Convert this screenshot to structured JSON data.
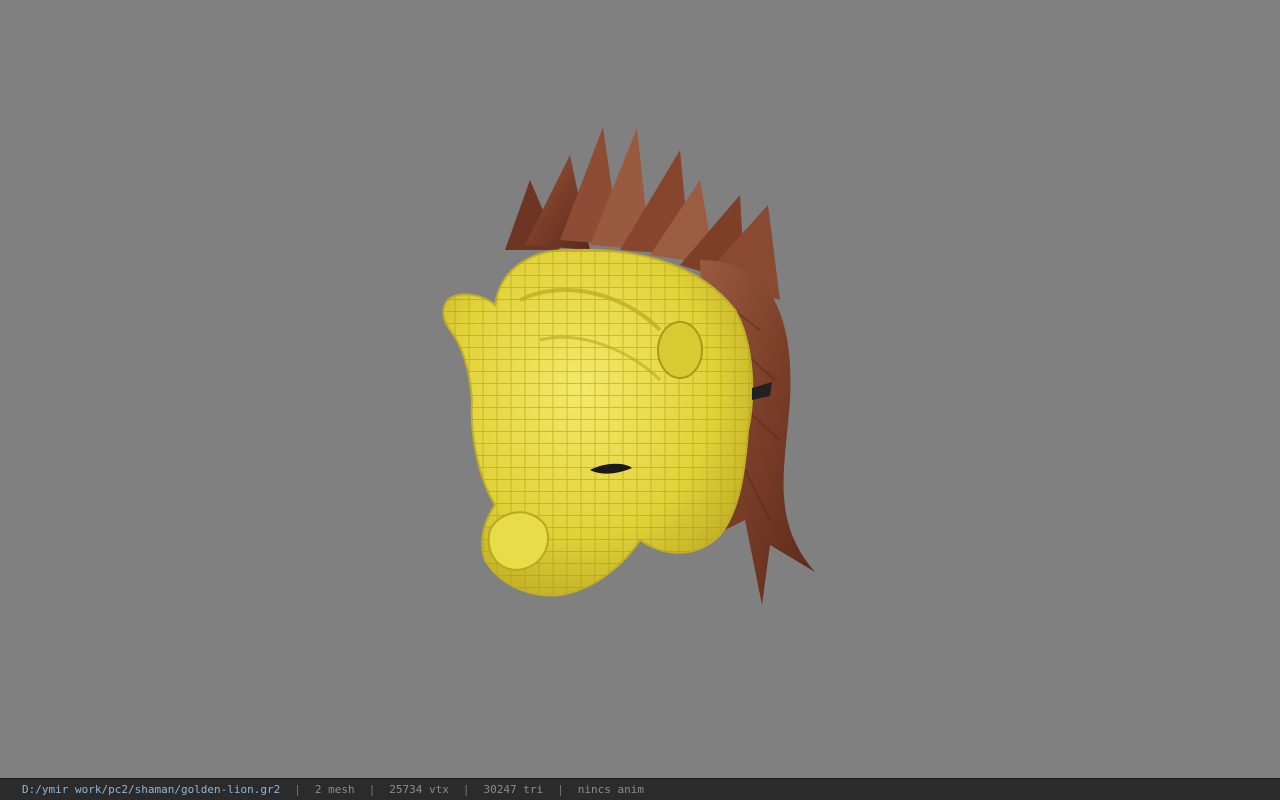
{
  "viewport": {
    "background": "#808080",
    "model_name": "golden-lion"
  },
  "statusbar": {
    "file_path": "D:/ymir work/pc2/shaman/golden-lion.gr2",
    "separator": "|",
    "mesh_count": "2 mesh",
    "vertex_count": "25734 vtx",
    "triangle_count": "30247 tri",
    "anim": "nincs anim"
  },
  "colors": {
    "lion_face": "#e6d83a",
    "lion_face_shadow": "#b8a820",
    "mane": "#8a4a32",
    "mane_dark": "#5a2a1a",
    "statusbar_bg": "#2b2b2b",
    "path_text": "#8fb6d8"
  }
}
